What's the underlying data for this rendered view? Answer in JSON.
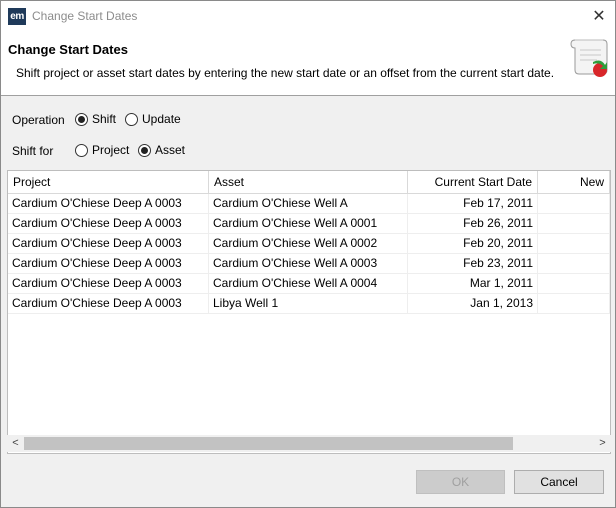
{
  "window": {
    "app_icon": "em",
    "title": "Change Start Dates",
    "close_glyph": "✕"
  },
  "header": {
    "title": "Change Start Dates",
    "description": "Shift project or asset start dates by entering the new start date or an offset from the current start date.",
    "icon": "scroll-document-icon"
  },
  "operation": {
    "label": "Operation",
    "options": [
      {
        "label": "Shift",
        "selected": true
      },
      {
        "label": "Update",
        "selected": false
      }
    ]
  },
  "shift_for": {
    "label": "Shift for",
    "options": [
      {
        "label": "Project",
        "selected": false
      },
      {
        "label": "Asset",
        "selected": true
      }
    ]
  },
  "table": {
    "columns": [
      "Project",
      "Asset",
      "Current Start Date",
      "New"
    ],
    "rows": [
      [
        "Cardium O'Chiese Deep A 0003",
        "Cardium O'Chiese Well A",
        "Feb 17, 2011",
        ""
      ],
      [
        "Cardium O'Chiese Deep A 0003",
        "Cardium O'Chiese Well A 0001",
        "Feb 26, 2011",
        ""
      ],
      [
        "Cardium O'Chiese Deep A 0003",
        "Cardium O'Chiese Well A 0002",
        "Feb 20, 2011",
        ""
      ],
      [
        "Cardium O'Chiese Deep A 0003",
        "Cardium O'Chiese Well A 0003",
        "Feb 23, 2011",
        ""
      ],
      [
        "Cardium O'Chiese Deep A 0003",
        "Cardium O'Chiese Well A 0004",
        "Mar 1, 2011",
        ""
      ],
      [
        "Cardium O'Chiese Deep A 0003",
        "Libya Well 1",
        "Jan 1, 2013",
        ""
      ]
    ]
  },
  "scrollbar": {
    "left_arrow": "<",
    "right_arrow": ">"
  },
  "buttons": {
    "ok": "OK",
    "cancel": "Cancel"
  }
}
